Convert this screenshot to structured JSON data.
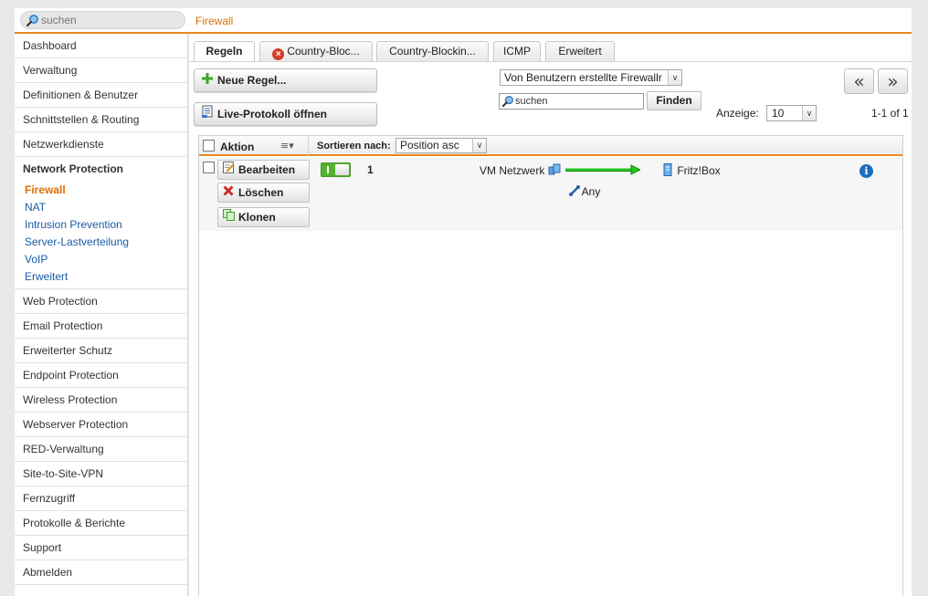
{
  "topbar": {
    "search_placeholder": "suchen",
    "page_title": "Firewall"
  },
  "sidebar": {
    "items_top": [
      {
        "label": "Dashboard",
        "name": "dashboard"
      },
      {
        "label": "Verwaltung",
        "name": "verwaltung"
      },
      {
        "label": "Definitionen & Benutzer",
        "name": "definitionen-benutzer"
      },
      {
        "label": "Schnittstellen & Routing",
        "name": "schnittstellen-routing"
      },
      {
        "label": "Netzwerkdienste",
        "name": "netzwerkdienste"
      }
    ],
    "active_group": "Network Protection",
    "sub_items": [
      {
        "label": "Firewall",
        "name": "firewall",
        "active": true
      },
      {
        "label": "NAT",
        "name": "nat",
        "active": false
      },
      {
        "label": "Intrusion Prevention",
        "name": "intrusion-prevention",
        "active": false
      },
      {
        "label": "Server-Lastverteilung",
        "name": "server-lastverteilung",
        "active": false
      },
      {
        "label": "VoIP",
        "name": "voip",
        "active": false
      },
      {
        "label": "Erweitert",
        "name": "erweitert",
        "active": false
      }
    ],
    "items_bottom": [
      {
        "label": "Web Protection",
        "name": "web-protection"
      },
      {
        "label": "Email Protection",
        "name": "email-protection"
      },
      {
        "label": "Erweiterter Schutz",
        "name": "erweiterter-schutz"
      },
      {
        "label": "Endpoint Protection",
        "name": "endpoint-protection"
      },
      {
        "label": "Wireless Protection",
        "name": "wireless-protection"
      },
      {
        "label": "Webserver Protection",
        "name": "webserver-protection"
      },
      {
        "label": "RED-Verwaltung",
        "name": "red-verwaltung"
      },
      {
        "label": "Site-to-Site-VPN",
        "name": "site-to-site-vpn"
      },
      {
        "label": "Fernzugriff",
        "name": "fernzugriff"
      },
      {
        "label": "Protokolle & Berichte",
        "name": "protokolle-berichte"
      },
      {
        "label": "Support",
        "name": "support"
      },
      {
        "label": "Abmelden",
        "name": "abmelden"
      }
    ]
  },
  "tabs": [
    {
      "label": "Regeln",
      "active": true,
      "error": false
    },
    {
      "label": "Country-Bloc...",
      "active": false,
      "error": true
    },
    {
      "label": "Country-Blockin...",
      "active": false,
      "error": false
    },
    {
      "label": "ICMP",
      "active": false,
      "error": false
    },
    {
      "label": "Erweitert",
      "active": false,
      "error": false
    }
  ],
  "toolbar": {
    "new_rule_label": "Neue Regel...",
    "live_log_label": "Live-Protokoll öffnen",
    "filter_value": "Von Benutzern erstellte Firewallr",
    "search_value": "suchen",
    "find_label": "Finden",
    "pager_prev": "«",
    "pager_next": "»",
    "display_label": "Anzeige:",
    "display_value": "10",
    "range_label": "1-1 of 1"
  },
  "table": {
    "action_header": "Aktion",
    "sort_label": "Sortieren nach:",
    "sort_value": "Position asc",
    "rows": [
      {
        "edit_label": "Bearbeiten",
        "delete_label": "Löschen",
        "clone_label": "Klonen",
        "position": "1",
        "source": "VM Netzwerk",
        "service": "Any",
        "destination": "Fritz!Box",
        "enabled": true
      }
    ]
  },
  "colors": {
    "accent": "#e8891a",
    "active_nav": "#e07000",
    "link": "#1a5aa8",
    "toggle_on": "#54b22e",
    "arrow": "#22c41e"
  }
}
